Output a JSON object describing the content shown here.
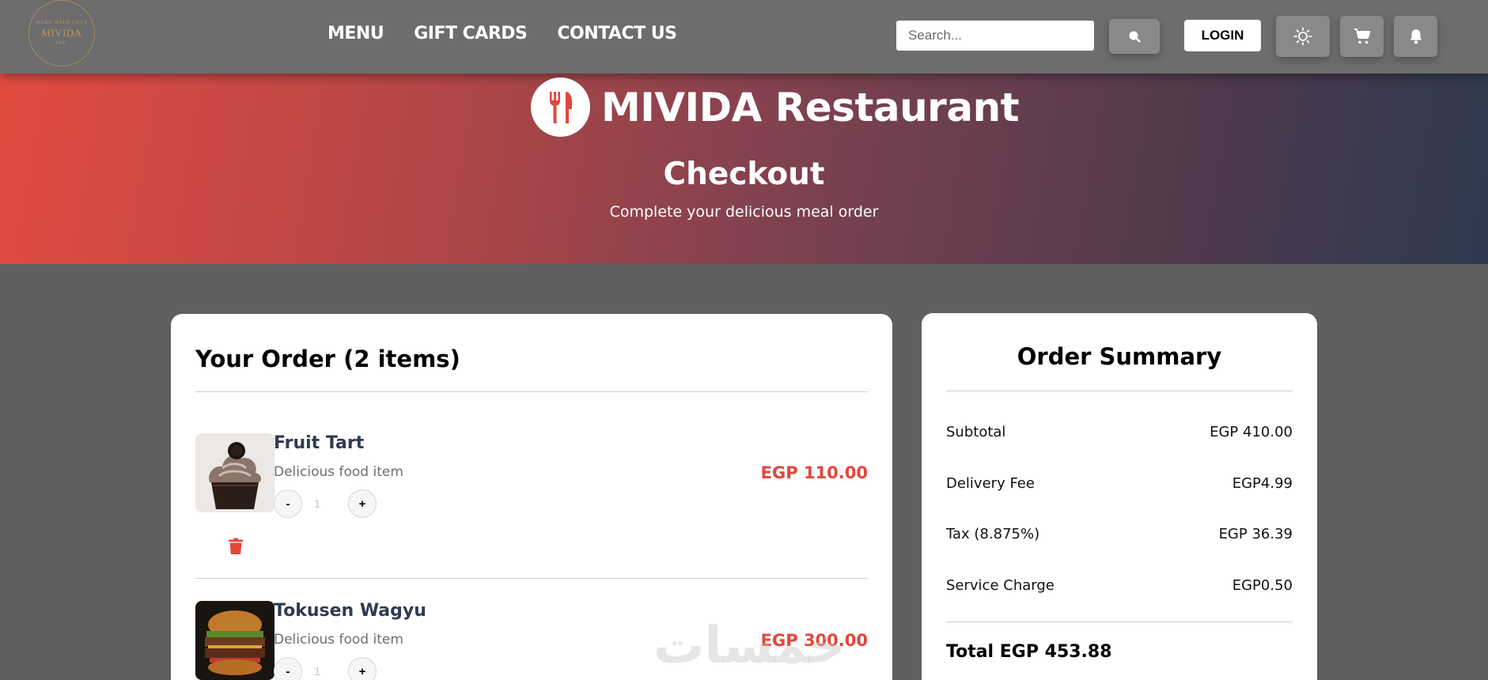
{
  "header": {
    "logo": {
      "top_text": "MADE WITH LOVE",
      "name": "MIVIDA",
      "bottom_text": "EST.",
      "icon": "restaurant-logo"
    },
    "nav": [
      "MENU",
      "GIFT CARDS",
      "CONTACT US"
    ],
    "search": {
      "placeholder": "Search...",
      "value": "",
      "icon": "search-icon"
    },
    "login_label": "LOGIN",
    "icons": [
      "sun-icon",
      "cart-icon",
      "bell-icon"
    ]
  },
  "hero": {
    "brand_name": "MIVIDA Restaurant",
    "brand_icon": "utensils-icon",
    "title": "Checkout",
    "subtitle": "Complete your delicious meal order",
    "gradient": [
      "#e24b40",
      "#2e3a4f"
    ]
  },
  "order": {
    "title": "Your Order (2 items)",
    "items": [
      {
        "name": "Fruit Tart",
        "description": "Delicious food item",
        "price": "EGP 110.00",
        "quantity": "1",
        "minus": "-",
        "plus": "+",
        "image": "cupcake-image"
      },
      {
        "name": "Tokusen Wagyu",
        "description": "Delicious food item",
        "price": "EGP 300.00",
        "quantity": "1",
        "minus": "-",
        "plus": "+",
        "image": "burger-image"
      }
    ],
    "remove_icon": "trash-icon"
  },
  "summary": {
    "title": "Order Summary",
    "rows": [
      {
        "label": "Subtotal",
        "value": "EGP 410.00"
      },
      {
        "label": "Delivery Fee",
        "value": "EGP4.99"
      },
      {
        "label": "Tax (8.875%)",
        "value": "EGP 36.39"
      },
      {
        "label": "Service Charge",
        "value": "EGP0.50"
      }
    ],
    "total": "Total EGP 453.88"
  },
  "watermark": "خمسات",
  "colors": {
    "accent": "#e2473b",
    "item_name": "#2f3b4f",
    "page_bg": "#5f5f5f"
  }
}
